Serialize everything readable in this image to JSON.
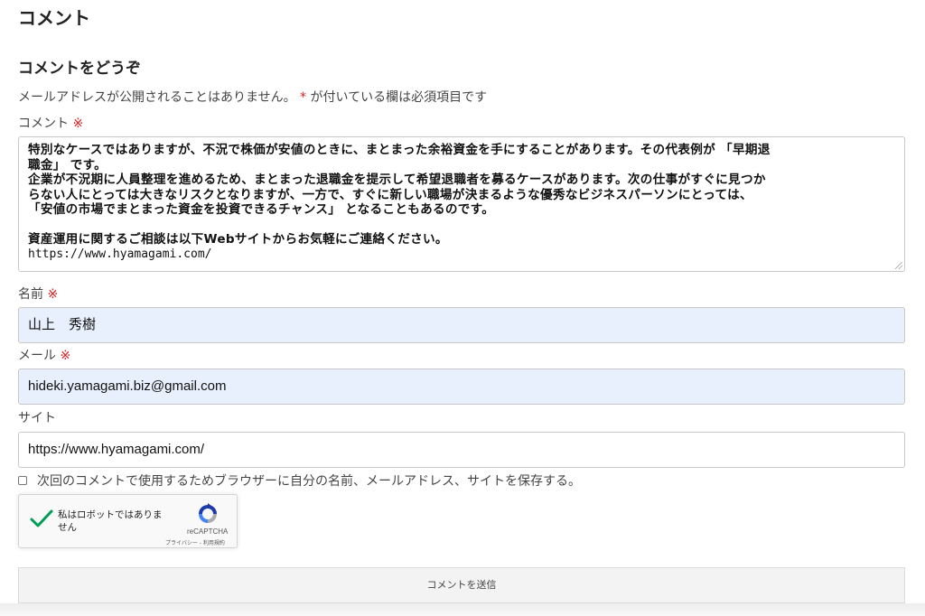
{
  "section_title": "コメント",
  "reply_title": "コメントをどうぞ",
  "notes": {
    "text_before": "メールアドレスが公開されることはありません。",
    "required_mark": "*",
    "text_after": "が付いている欄は必須項目です"
  },
  "comment_field": {
    "label": "コメント",
    "required_mark": "※",
    "lines": [
      "特別なケースではありますが、不況で株価が安値のときに、まとまった余裕資金を手にすることがあります。その代表例が 「早期退",
      "職金」 です。",
      "企業が不況期に人員整理を進めるため、まとまった退職金を提示して希望退職者を募るケースがあります。次の仕事がすぐに見つか",
      "らない人にとっては大きなリスクとなりますが、一方で、すぐに新しい職場が決まるような優秀なビジネスパーソンにとっては、",
      "「安値の市場でまとまった資金を投資できるチャンス」 となることもあるのです。",
      "",
      "資産運用に関するご相談は以下Webサイトからお気軽にご連絡ください。",
      "https://www.hyamagami.com/"
    ]
  },
  "name_field": {
    "label": "名前",
    "required_mark": "※",
    "value": "山上　秀樹"
  },
  "email_field": {
    "label": "メール",
    "required_mark": "※",
    "value": "hideki.yamagami.biz@gmail.com"
  },
  "site_field": {
    "label": "サイト",
    "value": "https://www.hyamagami.com/"
  },
  "cookie_consent": {
    "label": "次回のコメントで使用するためブラウザーに自分の名前、メールアドレス、サイトを保存する。",
    "checked": false
  },
  "captcha": {
    "text": "私はロボットではありません",
    "brand": "reCAPTCHA",
    "links": "プライバシー - 利用規約"
  },
  "submit": {
    "label": "コメントを送信"
  },
  "colors": {
    "required": "#e02020",
    "autofill_bg": "#e8f0fe",
    "captcha_check": "#009e55",
    "captcha_logo_blue": "#1c3aa9",
    "captcha_logo_light": "#4285f4",
    "captcha_logo_gray": "#ababab"
  }
}
